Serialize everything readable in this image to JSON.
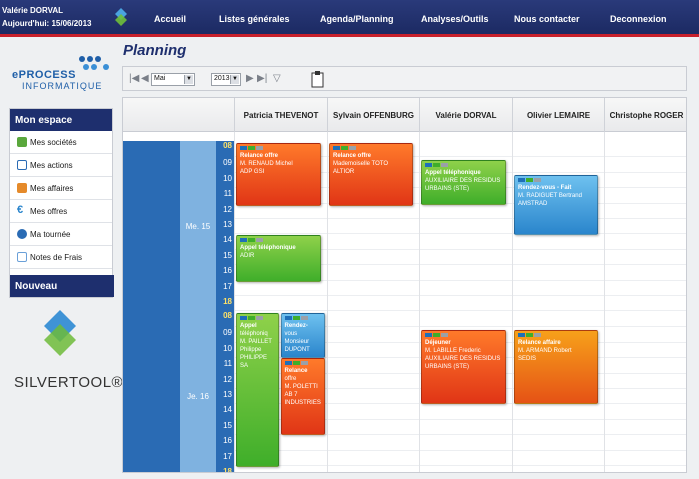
{
  "header": {
    "user_name": "Valérie DORVAL",
    "today": "Aujourd'hui: 15/06/2013",
    "nav": [
      "Accueil",
      "Listes générales",
      "Agenda/Planning",
      "Analyses/Outils",
      "Nous contacter",
      "Deconnexion"
    ]
  },
  "brand": {
    "line1": "ePROCESS",
    "line2": "INFORMATIQUE"
  },
  "sidebar": {
    "title": "Mon espace",
    "items": [
      {
        "label": "Mes sociétés",
        "icon": "buildings-icon"
      },
      {
        "label": "Mes actions",
        "icon": "calendar-icon"
      },
      {
        "label": "Mes affaires",
        "icon": "briefcase-icon"
      },
      {
        "label": "Mes offres",
        "icon": "euro-icon"
      },
      {
        "label": "Ma tournée",
        "icon": "car-icon"
      },
      {
        "label": "Notes de Frais",
        "icon": "receipt-icon"
      }
    ],
    "footer": "Nouveau"
  },
  "silvertool": {
    "label": "SILVERTOOL®"
  },
  "planning": {
    "title": "Planning",
    "month": "Mai",
    "year": "2013",
    "people": [
      "Patricia THEVENOT",
      "Sylvain OFFENBURG",
      "Valérie DORVAL",
      "Olivier LEMAIRE",
      "Christophe ROGER"
    ],
    "days": [
      {
        "label": "Me. 15",
        "hours": [
          "08",
          "09",
          "10",
          "11",
          "12",
          "13",
          "14",
          "15",
          "16",
          "17",
          "18"
        ]
      },
      {
        "label": "Je. 16",
        "hours": [
          "08",
          "09",
          "10",
          "11",
          "12",
          "13",
          "14",
          "15",
          "16",
          "17",
          "18"
        ]
      }
    ],
    "events": [
      {
        "col": 0,
        "day": 0,
        "start": 8,
        "end": 12.1,
        "style": "red",
        "lines": [
          "Relance offre",
          "M. RENAUD Michel",
          "ADP GSI"
        ]
      },
      {
        "col": 1,
        "day": 0,
        "start": 8,
        "end": 12.1,
        "style": "red",
        "lines": [
          "Relance offre",
          "Mademoiselle TOTO",
          "ALTIOR"
        ]
      },
      {
        "col": 2,
        "day": 0,
        "start": 9.1,
        "end": 12,
        "style": "green",
        "lines": [
          "Appel téléphonique",
          "",
          "AUXILIAIRE DES RESIDUS",
          "URBAINS (STE)"
        ]
      },
      {
        "col": 3,
        "day": 0,
        "start": 10.1,
        "end": 14,
        "style": "blue",
        "lines": [
          "Rendez-vous - Fait",
          "M. RADIGUET Bertrand",
          "AMSTRAD"
        ]
      },
      {
        "col": 0,
        "day": 0,
        "start": 14,
        "end": 17,
        "style": "green",
        "lines": [
          "Appel téléphonique",
          "",
          "ADIR"
        ]
      },
      {
        "col": 0,
        "day": 1,
        "start": 8,
        "end": 18,
        "style": "green",
        "lines": [
          "Appel",
          "téléphoniq",
          "M. PAILLET",
          "Philippe",
          "PHILIPPE SA"
        ]
      },
      {
        "col": 0.5,
        "day": 1,
        "start": 8,
        "end": 10.9,
        "style": "blue",
        "lines": [
          "Rendez-",
          "vous",
          "Monsieur",
          "DUPONT"
        ]
      },
      {
        "col": 0.5,
        "day": 1,
        "start": 10.9,
        "end": 15.9,
        "style": "red",
        "lines": [
          "Relance",
          "offre",
          "M. POLETTI",
          "AB 7",
          "INDUSTRIES"
        ]
      },
      {
        "col": 2,
        "day": 1,
        "start": 9.1,
        "end": 13.9,
        "style": "red",
        "lines": [
          "Déjeuner",
          "M. LABILLE Frederic",
          "AUXILIAIRE DES RESIDUS",
          "URBAINS (STE)"
        ]
      },
      {
        "col": 3,
        "day": 1,
        "start": 9.1,
        "end": 13.9,
        "style": "orange",
        "lines": [
          "Relance affaire",
          "M. ARMAND Robert",
          "SEDIS"
        ]
      }
    ]
  }
}
